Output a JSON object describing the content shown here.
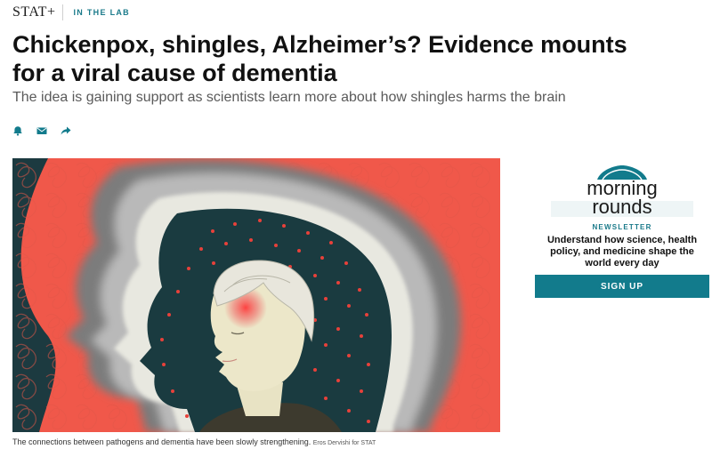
{
  "header": {
    "logo": "STAT+",
    "section": "IN THE LAB"
  },
  "article": {
    "headline": "Chickenpox, shingles, Alzheimer’s? Evidence mounts for a viral cause of dementia",
    "dek": "The idea is gaining support as scientists learn more about how shingles harms the brain",
    "share_icons": [
      "bell-icon",
      "envelope-icon",
      "share-arrow-icon"
    ],
    "image_caption": "The connections between pathogens and dementia have been slowly strengthening.",
    "image_credit": "Eros Dervishi for STAT"
  },
  "newsletter": {
    "logo_line1": "morning",
    "logo_line2": "rounds",
    "label": "NEWSLETTER",
    "description": "Understand how science, health policy, and medicine shape the world every day",
    "button": "SIGN UP"
  },
  "colors": {
    "accent": "#127b8c",
    "illustration_red": "#f0584a",
    "illustration_navy": "#1c3a40"
  }
}
